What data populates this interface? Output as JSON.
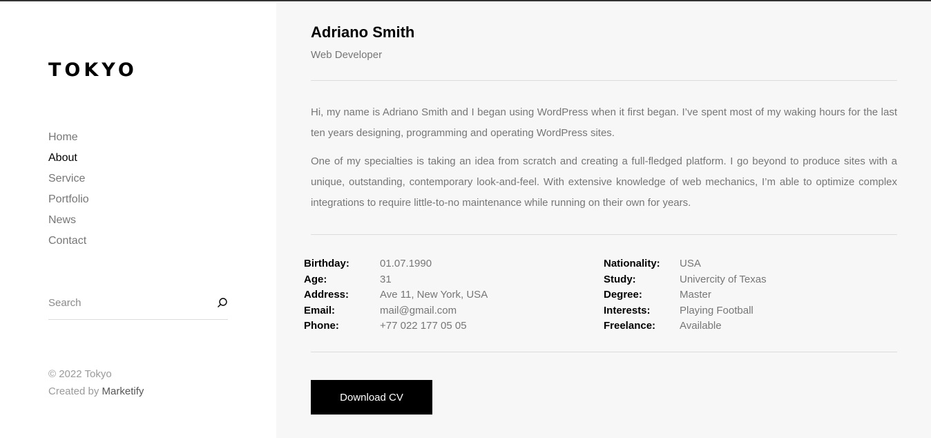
{
  "sidebar": {
    "logo": "TOKYO",
    "nav": [
      "Home",
      "About",
      "Service",
      "Portfolio",
      "News",
      "Contact"
    ],
    "active_nav": "About",
    "search_placeholder": "Search",
    "copyright": "© 2022 Tokyo",
    "created_by_prefix": "Created by ",
    "created_by_link": "Marketify"
  },
  "main": {
    "name": "Adriano Smith",
    "role": "Web Developer",
    "bio": [
      "Hi, my name is Adriano Smith and I began using WordPress when it first began. I’ve spent most of my waking hours for the last ten years designing, programming and operating WordPress sites.",
      "One of my specialties is taking an idea from scratch and creating a full-fledged platform. I go beyond to produce sites with a unique, outstanding, contemporary look-and-feel. With extensive knowledge of web mechanics, I’m able to optimize complex integrations to require little-to-no maintenance while running on their own for years."
    ],
    "info_left": [
      {
        "label": "Birthday:",
        "value": "01.07.1990"
      },
      {
        "label": "Age:",
        "value": "31"
      },
      {
        "label": "Address:",
        "value": "Ave 11, New York, USA"
      },
      {
        "label": "Email:",
        "value": "mail@gmail.com"
      },
      {
        "label": "Phone:",
        "value": "+77 022 177 05 05"
      }
    ],
    "info_right": [
      {
        "label": "Nationality:",
        "value": "USA"
      },
      {
        "label": "Study:",
        "value": "Univercity of Texas"
      },
      {
        "label": "Degree:",
        "value": "Master"
      },
      {
        "label": "Interests:",
        "value": "Playing Football"
      },
      {
        "label": "Freelance:",
        "value": "Available"
      }
    ],
    "download_label": "Download CV"
  }
}
